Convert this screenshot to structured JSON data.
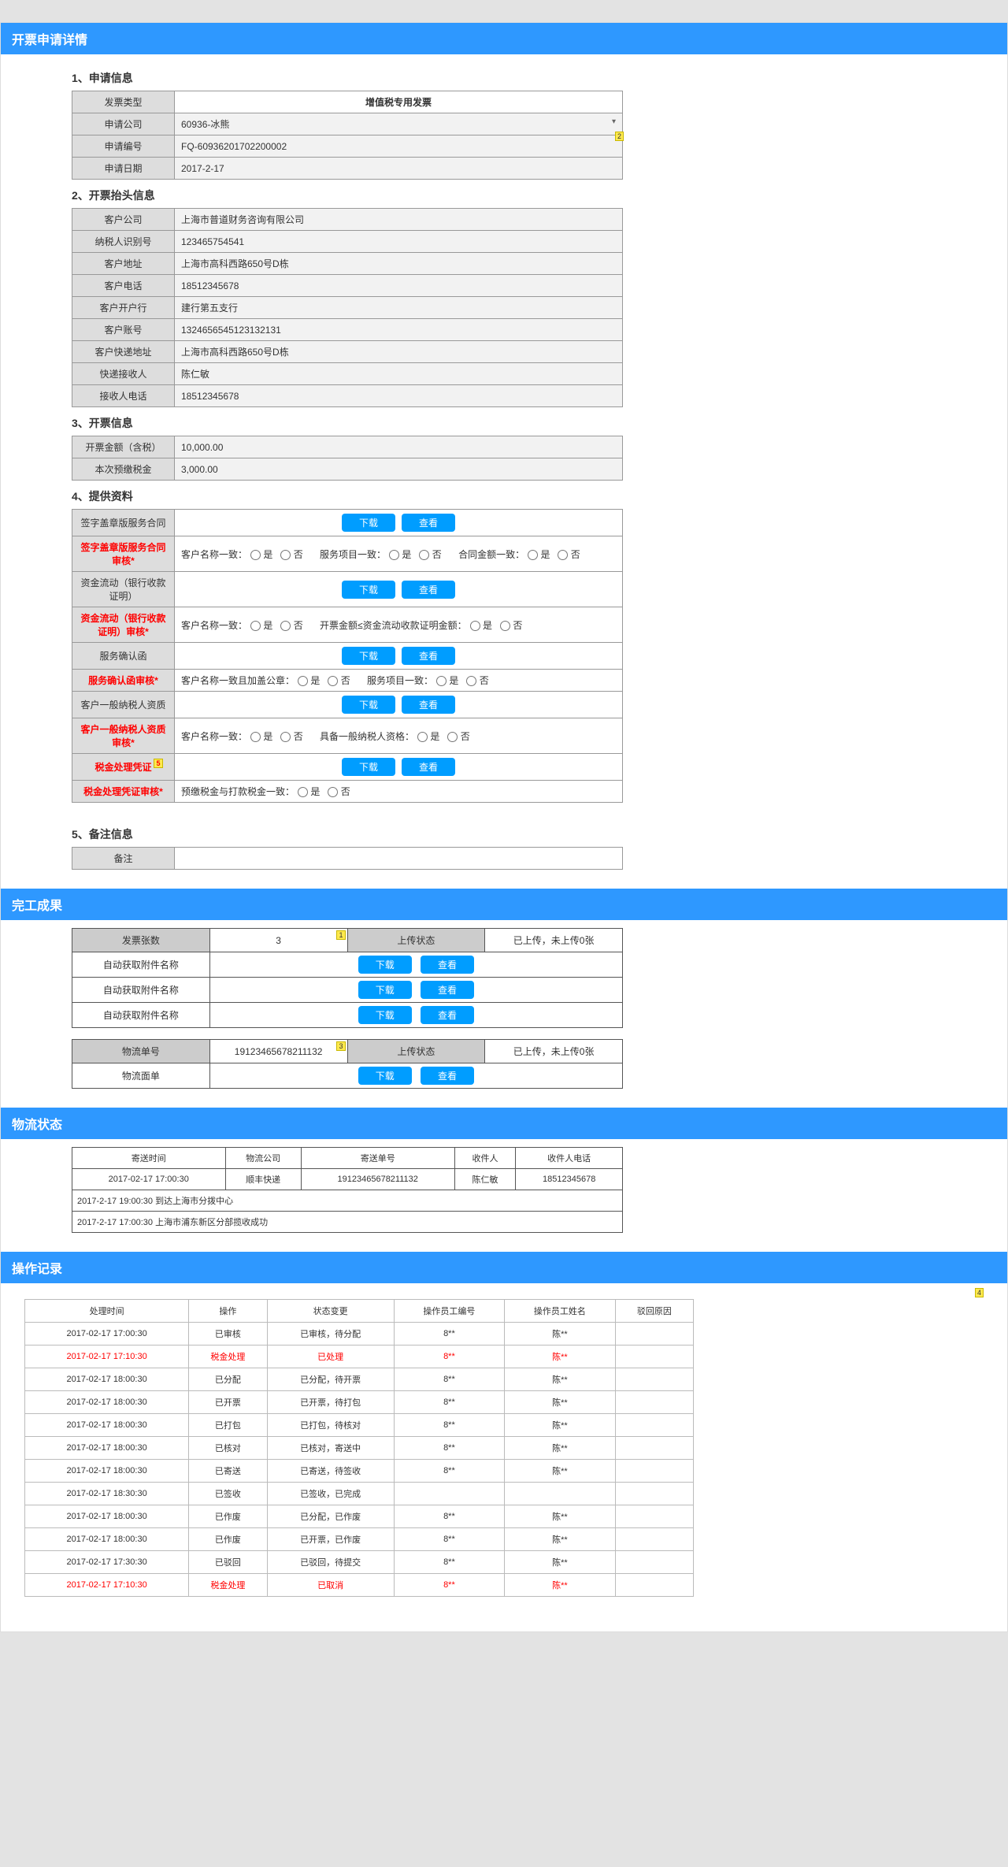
{
  "headers": {
    "detail": "开票申请详情",
    "result": "完工成果",
    "logistics": "物流状态",
    "oplog": "操作记录"
  },
  "section1": {
    "title": "1、申请信息",
    "rows": {
      "invoice_type_label": "发票类型",
      "invoice_type_value": "增值税专用发票",
      "company_label": "申请公司",
      "company_value": "60936-冰熊",
      "apply_no_label": "申请编号",
      "apply_no_value": "FQ-60936201702200002",
      "apply_date_label": "申请日期",
      "apply_date_value": "2017-2-17"
    }
  },
  "section2": {
    "title": "2、开票抬头信息",
    "rows": [
      {
        "label": "客户公司",
        "value": "上海市普道财务咨询有限公司"
      },
      {
        "label": "纳税人识别号",
        "value": "123465754541"
      },
      {
        "label": "客户地址",
        "value": "上海市高科西路650号D栋"
      },
      {
        "label": "客户电话",
        "value": "18512345678"
      },
      {
        "label": "客户开户行",
        "value": "建行第五支行"
      },
      {
        "label": "客户账号",
        "value": "1324656545123132131"
      },
      {
        "label": "客户快递地址",
        "value": "上海市高科西路650号D栋"
      },
      {
        "label": "快递接收人",
        "value": "陈仁敏"
      },
      {
        "label": "接收人电话",
        "value": "18512345678"
      }
    ]
  },
  "section3": {
    "title": "3、开票信息",
    "rows": [
      {
        "label": "开票金额（含税）",
        "value": "10,000.00"
      },
      {
        "label": "本次预缴税金",
        "value": "3,000.00"
      }
    ]
  },
  "section4": {
    "title": "4、提供资料",
    "download": "下载",
    "view": "查看",
    "items": [
      {
        "label": "签字盖章版服务合同",
        "type": "file"
      },
      {
        "label": "签字盖章版服务合同审核*",
        "type": "audit",
        "red": true,
        "checks": [
          {
            "q": "客户名称一致：",
            "opts": [
              "是",
              "否"
            ]
          },
          {
            "q": "服务项目一致：",
            "opts": [
              "是",
              "否"
            ]
          },
          {
            "q": "合同金额一致：",
            "opts": [
              "是",
              "否"
            ]
          }
        ]
      },
      {
        "label": "资金流动（银行收款证明）",
        "type": "file"
      },
      {
        "label": "资金流动（银行收款证明）审核*",
        "type": "audit",
        "red": true,
        "checks": [
          {
            "q": "客户名称一致：",
            "opts": [
              "是",
              "否"
            ]
          },
          {
            "q": "开票金额≤资金流动收款证明金额：",
            "opts": [
              "是",
              "否"
            ]
          }
        ]
      },
      {
        "label": "服务确认函",
        "type": "file"
      },
      {
        "label": "服务确认函审核*",
        "type": "audit",
        "red": true,
        "checks": [
          {
            "q": "客户名称一致且加盖公章：",
            "opts": [
              "是",
              "否"
            ]
          },
          {
            "q": "服务项目一致：",
            "opts": [
              "是",
              "否"
            ]
          }
        ]
      },
      {
        "label": "客户一般纳税人资质",
        "type": "file"
      },
      {
        "label": "客户一般纳税人资质审核*",
        "type": "audit",
        "red": true,
        "checks": [
          {
            "q": "客户名称一致：",
            "opts": [
              "是",
              "否"
            ]
          },
          {
            "q": "具备一般纳税人资格：",
            "opts": [
              "是",
              "否"
            ]
          }
        ]
      },
      {
        "label": "税金处理凭证",
        "type": "file",
        "red": true,
        "tag": "5"
      },
      {
        "label": "税金处理凭证审核*",
        "type": "audit",
        "red": true,
        "checks": [
          {
            "q": "预缴税金与打款税金一致：",
            "opts": [
              "是",
              "否"
            ]
          }
        ]
      }
    ]
  },
  "section5": {
    "title": "5、备注信息",
    "label": "备注",
    "value": ""
  },
  "result_table1": {
    "cols": [
      "发票张数",
      "3",
      "上传状态",
      "已上传，未上传0张"
    ],
    "row_label": "自动获取附件名称",
    "download": "下载",
    "view": "查看",
    "tag": "1"
  },
  "result_table2": {
    "cols": [
      "物流单号",
      "19123465678211132",
      "上传状态",
      "已上传，未上传0张"
    ],
    "row_label": "物流面单",
    "download": "下载",
    "view": "查看",
    "tag": "3"
  },
  "logistics": {
    "headers": [
      "寄送时间",
      "物流公司",
      "寄送单号",
      "收件人",
      "收件人电话"
    ],
    "row": [
      "2017-02-17  17:00:30",
      "顺丰快递",
      "19123465678211132",
      "陈仁敏",
      "18512345678"
    ],
    "events": [
      "2017-2-17  19:00:30    到达上海市分拨中心",
      "2017-2-17  17:00:30    上海市浦东新区分部揽收成功"
    ]
  },
  "oplog": {
    "headers": [
      "处理时间",
      "操作",
      "状态变更",
      "操作员工编号",
      "操作员工姓名",
      "驳回原因"
    ],
    "rows": [
      {
        "t": "2017-02-17  17:00:30",
        "op": "已审核",
        "st": "已审核，待分配",
        "id": "8**",
        "name": "陈**",
        "r": ""
      },
      {
        "t": "2017-02-17  17:10:30",
        "op": "税金处理",
        "st": "已处理",
        "id": "8**",
        "name": "陈**",
        "r": "",
        "red": true
      },
      {
        "t": "2017-02-17  18:00:30",
        "op": "已分配",
        "st": "已分配，待开票",
        "id": "8**",
        "name": "陈**",
        "r": ""
      },
      {
        "t": "2017-02-17  18:00:30",
        "op": "已开票",
        "st": "已开票，待打包",
        "id": "8**",
        "name": "陈**",
        "r": ""
      },
      {
        "t": "2017-02-17  18:00:30",
        "op": "已打包",
        "st": "已打包，待核对",
        "id": "8**",
        "name": "陈**",
        "r": ""
      },
      {
        "t": "2017-02-17  18:00:30",
        "op": "已核对",
        "st": "已核对，寄送中",
        "id": "8**",
        "name": "陈**",
        "r": ""
      },
      {
        "t": "2017-02-17  18:00:30",
        "op": "已寄送",
        "st": "已寄送，待签收",
        "id": "8**",
        "name": "陈**",
        "r": ""
      },
      {
        "t": "2017-02-17  18:30:30",
        "op": "已签收",
        "st": "已签收，已完成",
        "id": "",
        "name": "",
        "r": ""
      },
      {
        "t": "2017-02-17  18:00:30",
        "op": "已作废",
        "st": "已分配，已作废",
        "id": "8**",
        "name": "陈**",
        "r": ""
      },
      {
        "t": "2017-02-17  18:00:30",
        "op": "已作废",
        "st": "已开票，已作废",
        "id": "8**",
        "name": "陈**",
        "r": ""
      },
      {
        "t": "2017-02-17  17:30:30",
        "op": "已驳回",
        "st": "已驳回，待提交",
        "id": "8**",
        "name": "陈**",
        "r": ""
      },
      {
        "t": "2017-02-17  17:10:30",
        "op": "税金处理",
        "st": "已取消",
        "id": "8**",
        "name": "陈**",
        "r": "",
        "red": true
      }
    ],
    "tag": "4"
  },
  "tag2": "2"
}
